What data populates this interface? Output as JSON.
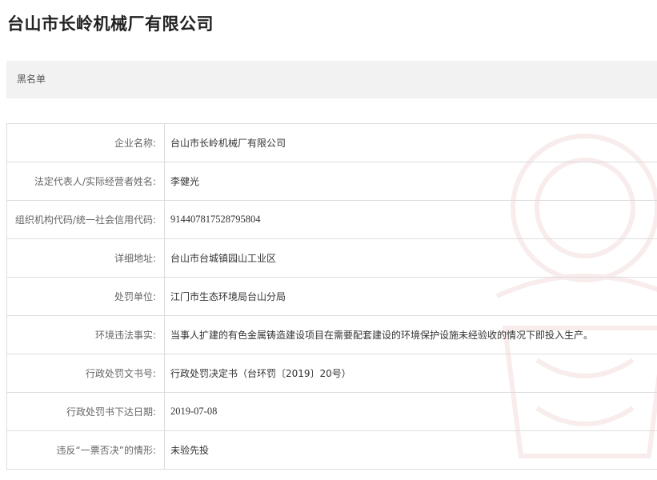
{
  "page": {
    "title": "台山市长岭机械厂有限公司",
    "section_label": "黑名单"
  },
  "record": {
    "rows": [
      {
        "label": "企业名称:",
        "value": "台山市长岭机械厂有限公司"
      },
      {
        "label": "法定代表人/实际经营者姓名:",
        "value": "李健光"
      },
      {
        "label": "组织机构代码/统一社会信用代码:",
        "value": "914407817528795804"
      },
      {
        "label": "详细地址:",
        "value": "台山市台城镇园山工业区"
      },
      {
        "label": "处罚单位:",
        "value": "江门市生态环境局台山分局"
      },
      {
        "label": "环境违法事实:",
        "value": "当事人扩建的有色金属铸造建设项目在需要配套建设的环境保护设施未经验收的情况下即投入生产。"
      },
      {
        "label": "行政处罚文书号:",
        "value": "行政处罚决定书（台环罚〔2019〕20号）"
      },
      {
        "label": "行政处罚书下达日期:",
        "value": "2019-07-08"
      },
      {
        "label": "违反“一票否决”的情形:",
        "value": "未验先投"
      }
    ]
  }
}
